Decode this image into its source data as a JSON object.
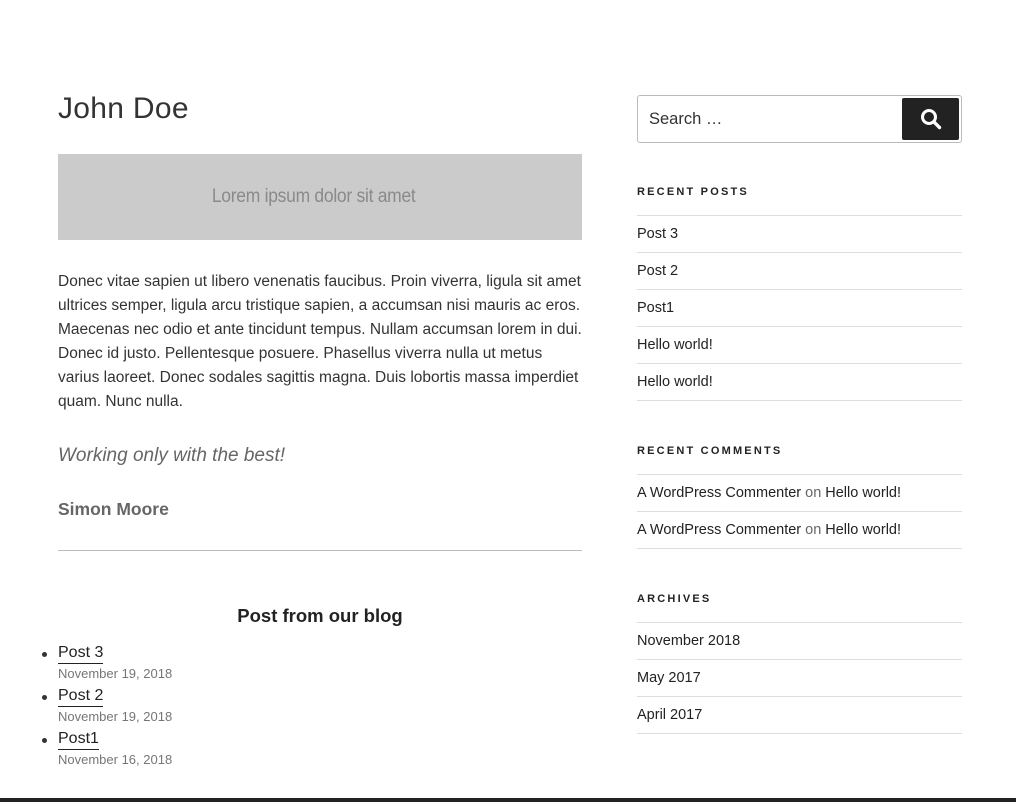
{
  "main": {
    "title": "John Doe",
    "banner_text": "Lorem ipsum dolor sit amet",
    "body_text": "Donec vitae sapien ut libero venenatis faucibus. Proin viverra, ligula sit amet ultrices semper, ligula arcu tristique sapien, a accumsan nisi mauris ac eros. Maecenas nec odio et ante tincidunt tempus. Nullam accumsan lorem in dui. Donec id justo. Pellentesque posuere. Phasellus viverra nulla ut metus varius laoreet. Donec sodales sagittis magna. Duis lobortis massa imperdiet quam. Nunc nulla.",
    "quote": "Working only with the best!",
    "signature": "Simon Moore",
    "blog_heading": "Post from our blog",
    "blog_posts": [
      {
        "title": "Post 3",
        "date": "November 19, 2018"
      },
      {
        "title": "Post 2",
        "date": "November 19, 2018"
      },
      {
        "title": "Post1",
        "date": "November 16, 2018"
      }
    ]
  },
  "sidebar": {
    "search": {
      "placeholder": "Search …",
      "button_icon": "search-icon"
    },
    "recent_posts": {
      "title": "Recent Posts",
      "items": [
        "Post 3",
        "Post 2",
        "Post1",
        "Hello world!",
        "Hello world!"
      ]
    },
    "recent_comments": {
      "title": "Recent Comments",
      "items": [
        {
          "author": "A WordPress Commenter",
          "connector": "on",
          "post": "Hello world!"
        },
        {
          "author": "A WordPress Commenter",
          "connector": "on",
          "post": "Hello world!"
        }
      ]
    },
    "archives": {
      "title": "Archives",
      "items": [
        "November 2018",
        "May 2017",
        "April 2017"
      ]
    }
  },
  "colors": {
    "text": "#333333",
    "banner_bg": "#cbcbcb",
    "button_bg": "#222222",
    "divider": "#dddddd"
  }
}
